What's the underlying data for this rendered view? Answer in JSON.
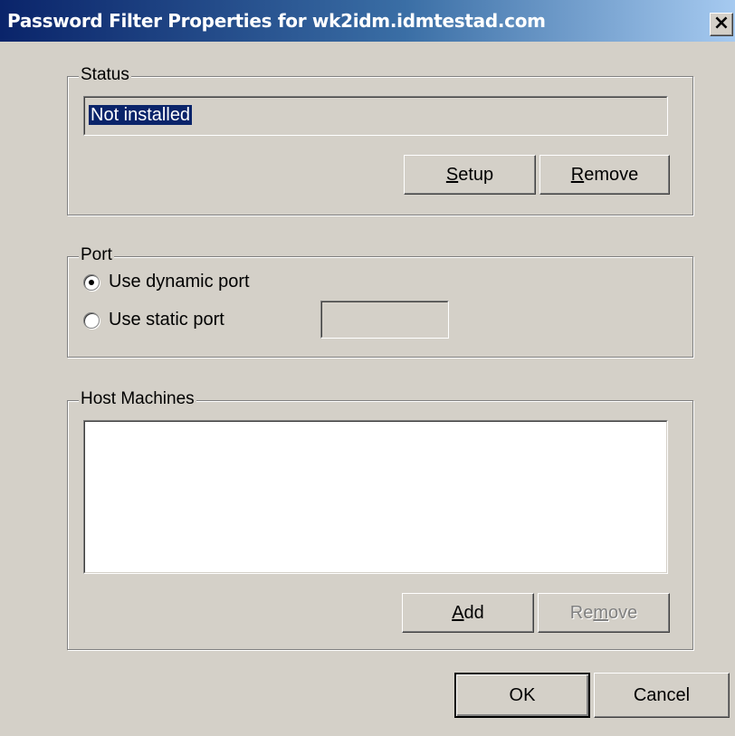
{
  "window": {
    "title": "Password Filter Properties for wk2idm.idmtestad.com",
    "close_glyph": "×"
  },
  "status": {
    "legend": "Status",
    "value": "Not installed",
    "setup": {
      "mnemonic": "S",
      "rest": "etup"
    },
    "remove": {
      "mnemonic": "R",
      "rest": "emove"
    }
  },
  "port": {
    "legend": "Port",
    "dynamic_label": "Use dynamic port",
    "static_label": "Use static port",
    "static_value": "",
    "selected": "dynamic"
  },
  "hosts": {
    "legend": "Host Machines",
    "items": [],
    "add": {
      "mnemonic": "A",
      "rest": "dd"
    },
    "remove": {
      "pre": "Re",
      "mnemonic": "m",
      "rest": "ove"
    }
  },
  "footer": {
    "ok_label": "OK",
    "cancel_label": "Cancel"
  }
}
